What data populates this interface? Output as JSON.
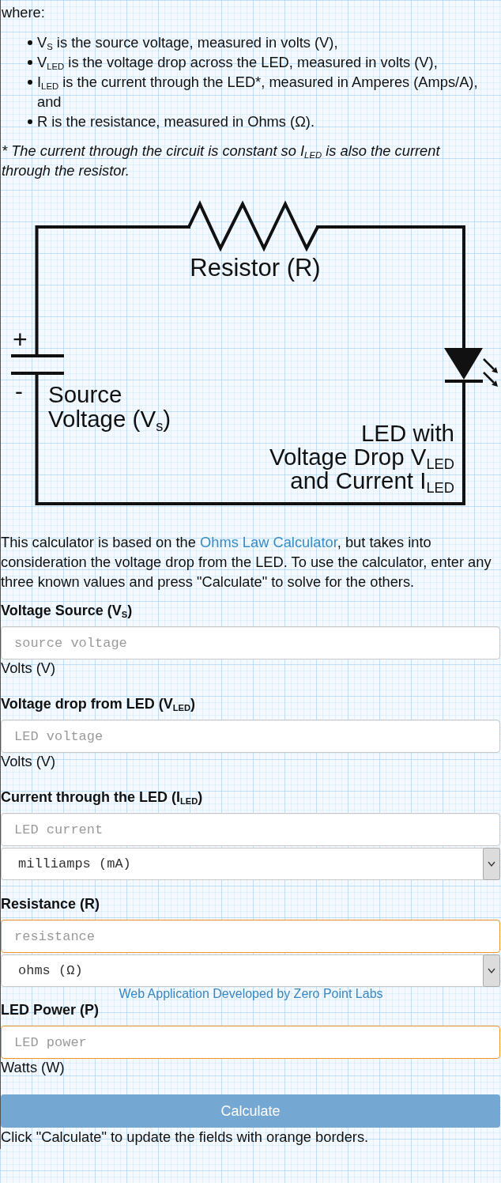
{
  "intro_label": "where:",
  "definitions": [
    "V$_{S}$ is the source voltage, measured in volts (V),",
    "V$_{LED}$ is the voltage drop across the LED, measured in volts (V),",
    "I$_{LED}$ is the current through the LED*, measured in Amperes (Amps/A), and",
    "R is the resistance, measured in Ohms (Ω)."
  ],
  "footnote": "* The current through the circuit is constant so I$_{LED}$ is also the current through the resistor.",
  "circuit": {
    "resistor_label": "Resistor (R)",
    "positive_sign": "+",
    "negative_sign": "-",
    "source_label": [
      "Source",
      "Voltage (V$_{s}$)"
    ],
    "led_label": [
      "LED with",
      "Voltage Drop V$_{LED}$",
      "and Current I$_{LED}$"
    ]
  },
  "description": {
    "before": "This calculator is based on the ",
    "link": "Ohms Law Calculator",
    "after": ", but takes into consideration the voltage drop from the LED. To use the calculator, enter any three known values and press \"Calculate\" to solve for the others."
  },
  "fields": [
    {
      "label": "Voltage Source (V$_{S}$)",
      "placeholder": "source voltage",
      "needs_update": false,
      "kind": "unit_text",
      "unit": "Volts (V)"
    },
    {
      "label": "Voltage drop from LED (V$_{LED}$)",
      "placeholder": "LED voltage",
      "needs_update": false,
      "kind": "unit_text",
      "unit": "Volts (V)"
    },
    {
      "label": "Current through the LED (I$_{LED}$)",
      "placeholder": "LED current",
      "needs_update": false,
      "kind": "unit_select",
      "unit": "milliamps (mA)"
    },
    {
      "label": "Resistance (R)",
      "placeholder": "resistance",
      "needs_update": true,
      "kind": "unit_select",
      "unit": "ohms (Ω)",
      "note": "Web Application Developed by Zero Point Labs"
    },
    {
      "label": "LED Power (P)",
      "placeholder": "LED power",
      "needs_update": true,
      "kind": "unit_text",
      "unit": "Watts (W)"
    }
  ],
  "calculate_button": "Calculate",
  "hint": "Click \"Calculate\" to update the fields with orange borders."
}
